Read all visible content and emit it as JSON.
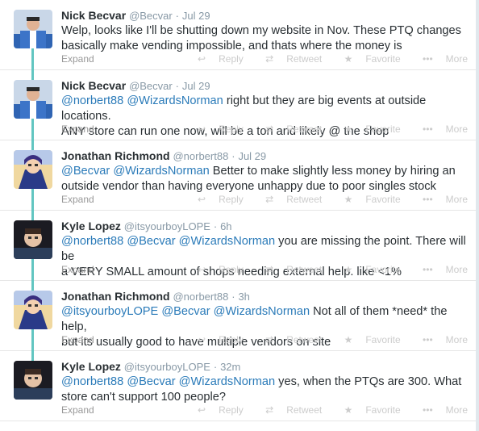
{
  "tweets": [
    {
      "name": "Nick Becvar",
      "handle": "@Becvar",
      "time": "Jul 29",
      "lines": [
        [
          {
            "t": "Welp, looks like I'll be shutting down my website in Nov. These PTQ changes"
          }
        ],
        [
          {
            "t": "basically make vending impossible, and thats where the money is"
          }
        ]
      ]
    },
    {
      "name": "Nick Becvar",
      "handle": "@Becvar",
      "time": "Jul 29",
      "lines": [
        [
          {
            "t": "@norbert88",
            "m": true
          },
          {
            "t": " "
          },
          {
            "t": "@WizardsNorman",
            "m": true
          },
          {
            "t": " right but they are big events at outside locations."
          }
        ],
        [
          {
            "t": "ANY store can run one now, will be a ton and likely @ the shop"
          }
        ]
      ]
    },
    {
      "name": "Jonathan Richmond",
      "handle": "@norbert88",
      "time": "Jul 29",
      "lines": [
        [
          {
            "t": "@Becvar",
            "m": true
          },
          {
            "t": " "
          },
          {
            "t": "@WizardsNorman",
            "m": true
          },
          {
            "t": " Better to make slightly less money by hiring an"
          }
        ],
        [
          {
            "t": "outside vendor than having everyone unhappy due to poor singles stock"
          }
        ]
      ]
    },
    {
      "name": "Kyle Lopez",
      "handle": "@itsyourboyLOPE",
      "time": "6h",
      "lines": [
        [
          {
            "t": "@norbert88",
            "m": true
          },
          {
            "t": " "
          },
          {
            "t": "@Becvar",
            "m": true
          },
          {
            "t": " "
          },
          {
            "t": "@WizardsNorman",
            "m": true
          },
          {
            "t": " you are missing the point. There will be"
          }
        ],
        [
          {
            "t": "a VERY SMALL amount of shops needing external help. like <1%"
          }
        ]
      ]
    },
    {
      "name": "Jonathan Richmond",
      "handle": "@norbert88",
      "time": "3h",
      "lines": [
        [
          {
            "t": "@itsyourboyLOPE",
            "m": true
          },
          {
            "t": " "
          },
          {
            "t": "@Becvar",
            "m": true
          },
          {
            "t": " "
          },
          {
            "t": "@WizardsNorman",
            "m": true
          },
          {
            "t": " Not all of them *need* the help,"
          }
        ],
        [
          {
            "t": "but its usually good to have multiple vendors on site"
          }
        ]
      ]
    },
    {
      "name": "Kyle Lopez",
      "handle": "@itsyourboyLOPE",
      "time": "32m",
      "lines": [
        [
          {
            "t": "@norbert88",
            "m": true
          },
          {
            "t": " "
          },
          {
            "t": "@Becvar",
            "m": true
          },
          {
            "t": " "
          },
          {
            "t": "@WizardsNorman",
            "m": true
          },
          {
            "t": " yes, when the PTQs are 300. What"
          }
        ],
        [
          {
            "t": "store can't support 100 people?"
          }
        ]
      ]
    }
  ],
  "actions": {
    "expand": "Expand",
    "reply": "Reply",
    "retweet": "Retweet",
    "favorite": "Favorite",
    "more": "More",
    "separator": "·"
  },
  "icons": {
    "reply": "reply-icon",
    "retweet": "retweet-icon",
    "favorite": "star-icon",
    "more": "more-dots-icon"
  },
  "colors": {
    "thread_line": "#62c6c1",
    "mention": "#2b7bb9",
    "name": "#292f33",
    "meta": "#8899a6",
    "action": "#cccccc"
  }
}
